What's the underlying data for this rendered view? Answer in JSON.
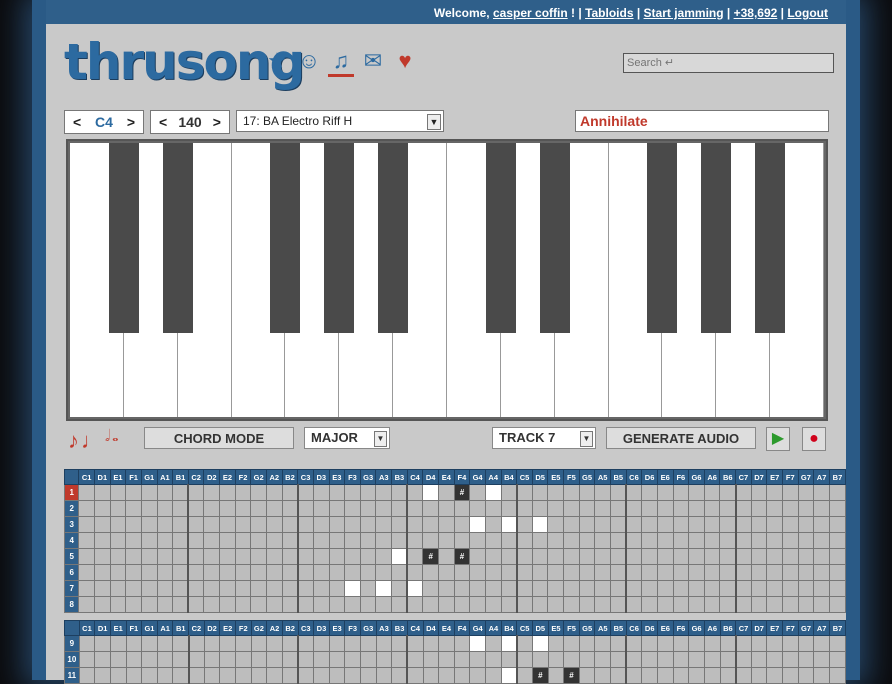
{
  "topbar": {
    "welcome": "Welcome,",
    "username": "casper coffin",
    "tabloids": "Tabloids",
    "start": "Start jamming",
    "points": "+38,692",
    "logout": "Logout"
  },
  "logo": "thrusong",
  "search": {
    "placeholder": "Search ↵"
  },
  "controls": {
    "octave": "C4",
    "tempo": "140",
    "patch": "17: BA Electro Riff H",
    "song_name": "Annihilate"
  },
  "toolbar": {
    "chord_mode": "CHORD MODE",
    "scale": "MAJOR",
    "track": "TRACK 7",
    "generate": "GENERATE AUDIO"
  },
  "note_lengths": [
    "♪",
    "♩",
    "𝅗𝅥",
    "𝅝"
  ],
  "grid": {
    "columns": [
      "C1",
      "D1",
      "E1",
      "F1",
      "G1",
      "A1",
      "B1",
      "C2",
      "D2",
      "E2",
      "F2",
      "G2",
      "A2",
      "B2",
      "C3",
      "D3",
      "E3",
      "F3",
      "G3",
      "A3",
      "B3",
      "C4",
      "D4",
      "E4",
      "F4",
      "G4",
      "A4",
      "B4",
      "C5",
      "D5",
      "E5",
      "F5",
      "G5",
      "A5",
      "B5",
      "C6",
      "D6",
      "E6",
      "F6",
      "G6",
      "A6",
      "B6",
      "C7",
      "D7",
      "E7",
      "F7",
      "G7",
      "A7",
      "B7"
    ],
    "block1_rows": [
      "1",
      "2",
      "3",
      "4",
      "5",
      "6",
      "7",
      "8"
    ],
    "block2_rows": [
      "9",
      "10",
      "11"
    ],
    "active_row": "1",
    "cells": [
      {
        "row": "1",
        "col": "D4",
        "type": "w"
      },
      {
        "row": "1",
        "col": "F4",
        "type": "b",
        "label": "#"
      },
      {
        "row": "1",
        "col": "A4",
        "type": "w"
      },
      {
        "row": "3",
        "col": "G4",
        "type": "w"
      },
      {
        "row": "3",
        "col": "B4",
        "type": "w"
      },
      {
        "row": "3",
        "col": "D5",
        "type": "w"
      },
      {
        "row": "5",
        "col": "B3",
        "type": "w"
      },
      {
        "row": "5",
        "col": "D4",
        "type": "b",
        "label": "#"
      },
      {
        "row": "5",
        "col": "F4",
        "type": "b",
        "label": "#"
      },
      {
        "row": "7",
        "col": "F3",
        "type": "w"
      },
      {
        "row": "7",
        "col": "A3",
        "type": "w"
      },
      {
        "row": "7",
        "col": "C4",
        "type": "w"
      },
      {
        "row": "9",
        "col": "G4",
        "type": "w"
      },
      {
        "row": "9",
        "col": "B4",
        "type": "w"
      },
      {
        "row": "9",
        "col": "D5",
        "type": "w"
      },
      {
        "row": "11",
        "col": "B4",
        "type": "w"
      },
      {
        "row": "11",
        "col": "D5",
        "type": "b",
        "label": "#"
      },
      {
        "row": "11",
        "col": "F5",
        "type": "b",
        "label": "#"
      }
    ]
  },
  "colors": {
    "accent": "#2f5f8a",
    "song": "#c0392b",
    "record": "#d0021b",
    "play": "#2c9a2c"
  }
}
